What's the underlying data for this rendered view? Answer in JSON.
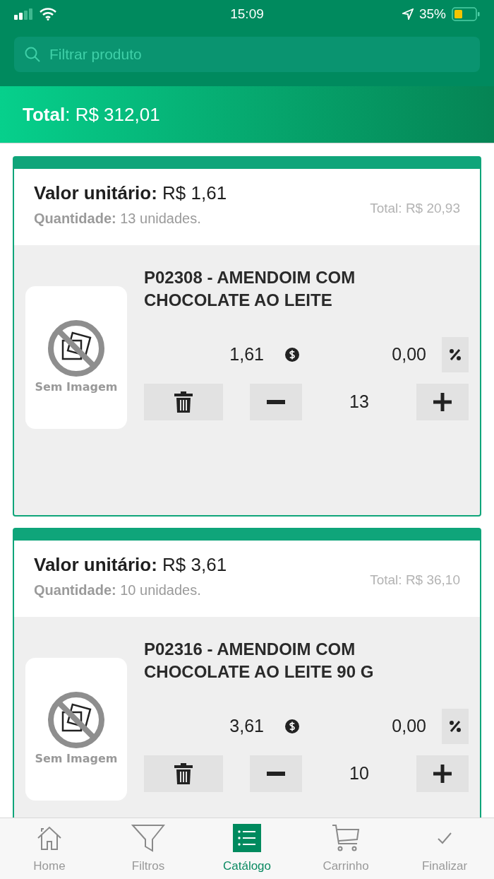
{
  "status_bar": {
    "time": "15:09",
    "battery": "35%"
  },
  "search": {
    "placeholder": "Filtrar produto"
  },
  "total": "**Total**: R$ 312,01",
  "items": [
    {
      "unit_price": "**Valor unitário:** R$ 1,61",
      "quantity": "**Quantidade:** 13 unidades.",
      "total": "Total: R$ 20,93",
      "image_label": "Sem Imagem",
      "name": "P02308 - AMENDOIM COM CHOCOLATE AO LEITE",
      "price": "1,61",
      "discount": "0,00",
      "qty": "13"
    },
    {
      "unit_price": "**Valor unitário:** R$ 3,61",
      "quantity": "**Quantidade:** 10 unidades.",
      "total": "Total: R$ 36,10",
      "image_label": "Sem Imagem",
      "name": "P02316 - AMENDOIM COM CHOCOLATE AO LEITE 90 G",
      "price": "3,61",
      "discount": "0,00",
      "qty": "10"
    }
  ],
  "tabs": [
    {
      "kind": "home",
      "label": "Home",
      "selected": false
    },
    {
      "kind": "filter",
      "label": "Filtros",
      "selected": false
    },
    {
      "kind": "catalog",
      "label": "Catálogo",
      "selected": true
    },
    {
      "kind": "cart",
      "label": "Carrinho",
      "selected": false
    },
    {
      "kind": "check",
      "label": "Finalizar",
      "selected": false
    }
  ]
}
